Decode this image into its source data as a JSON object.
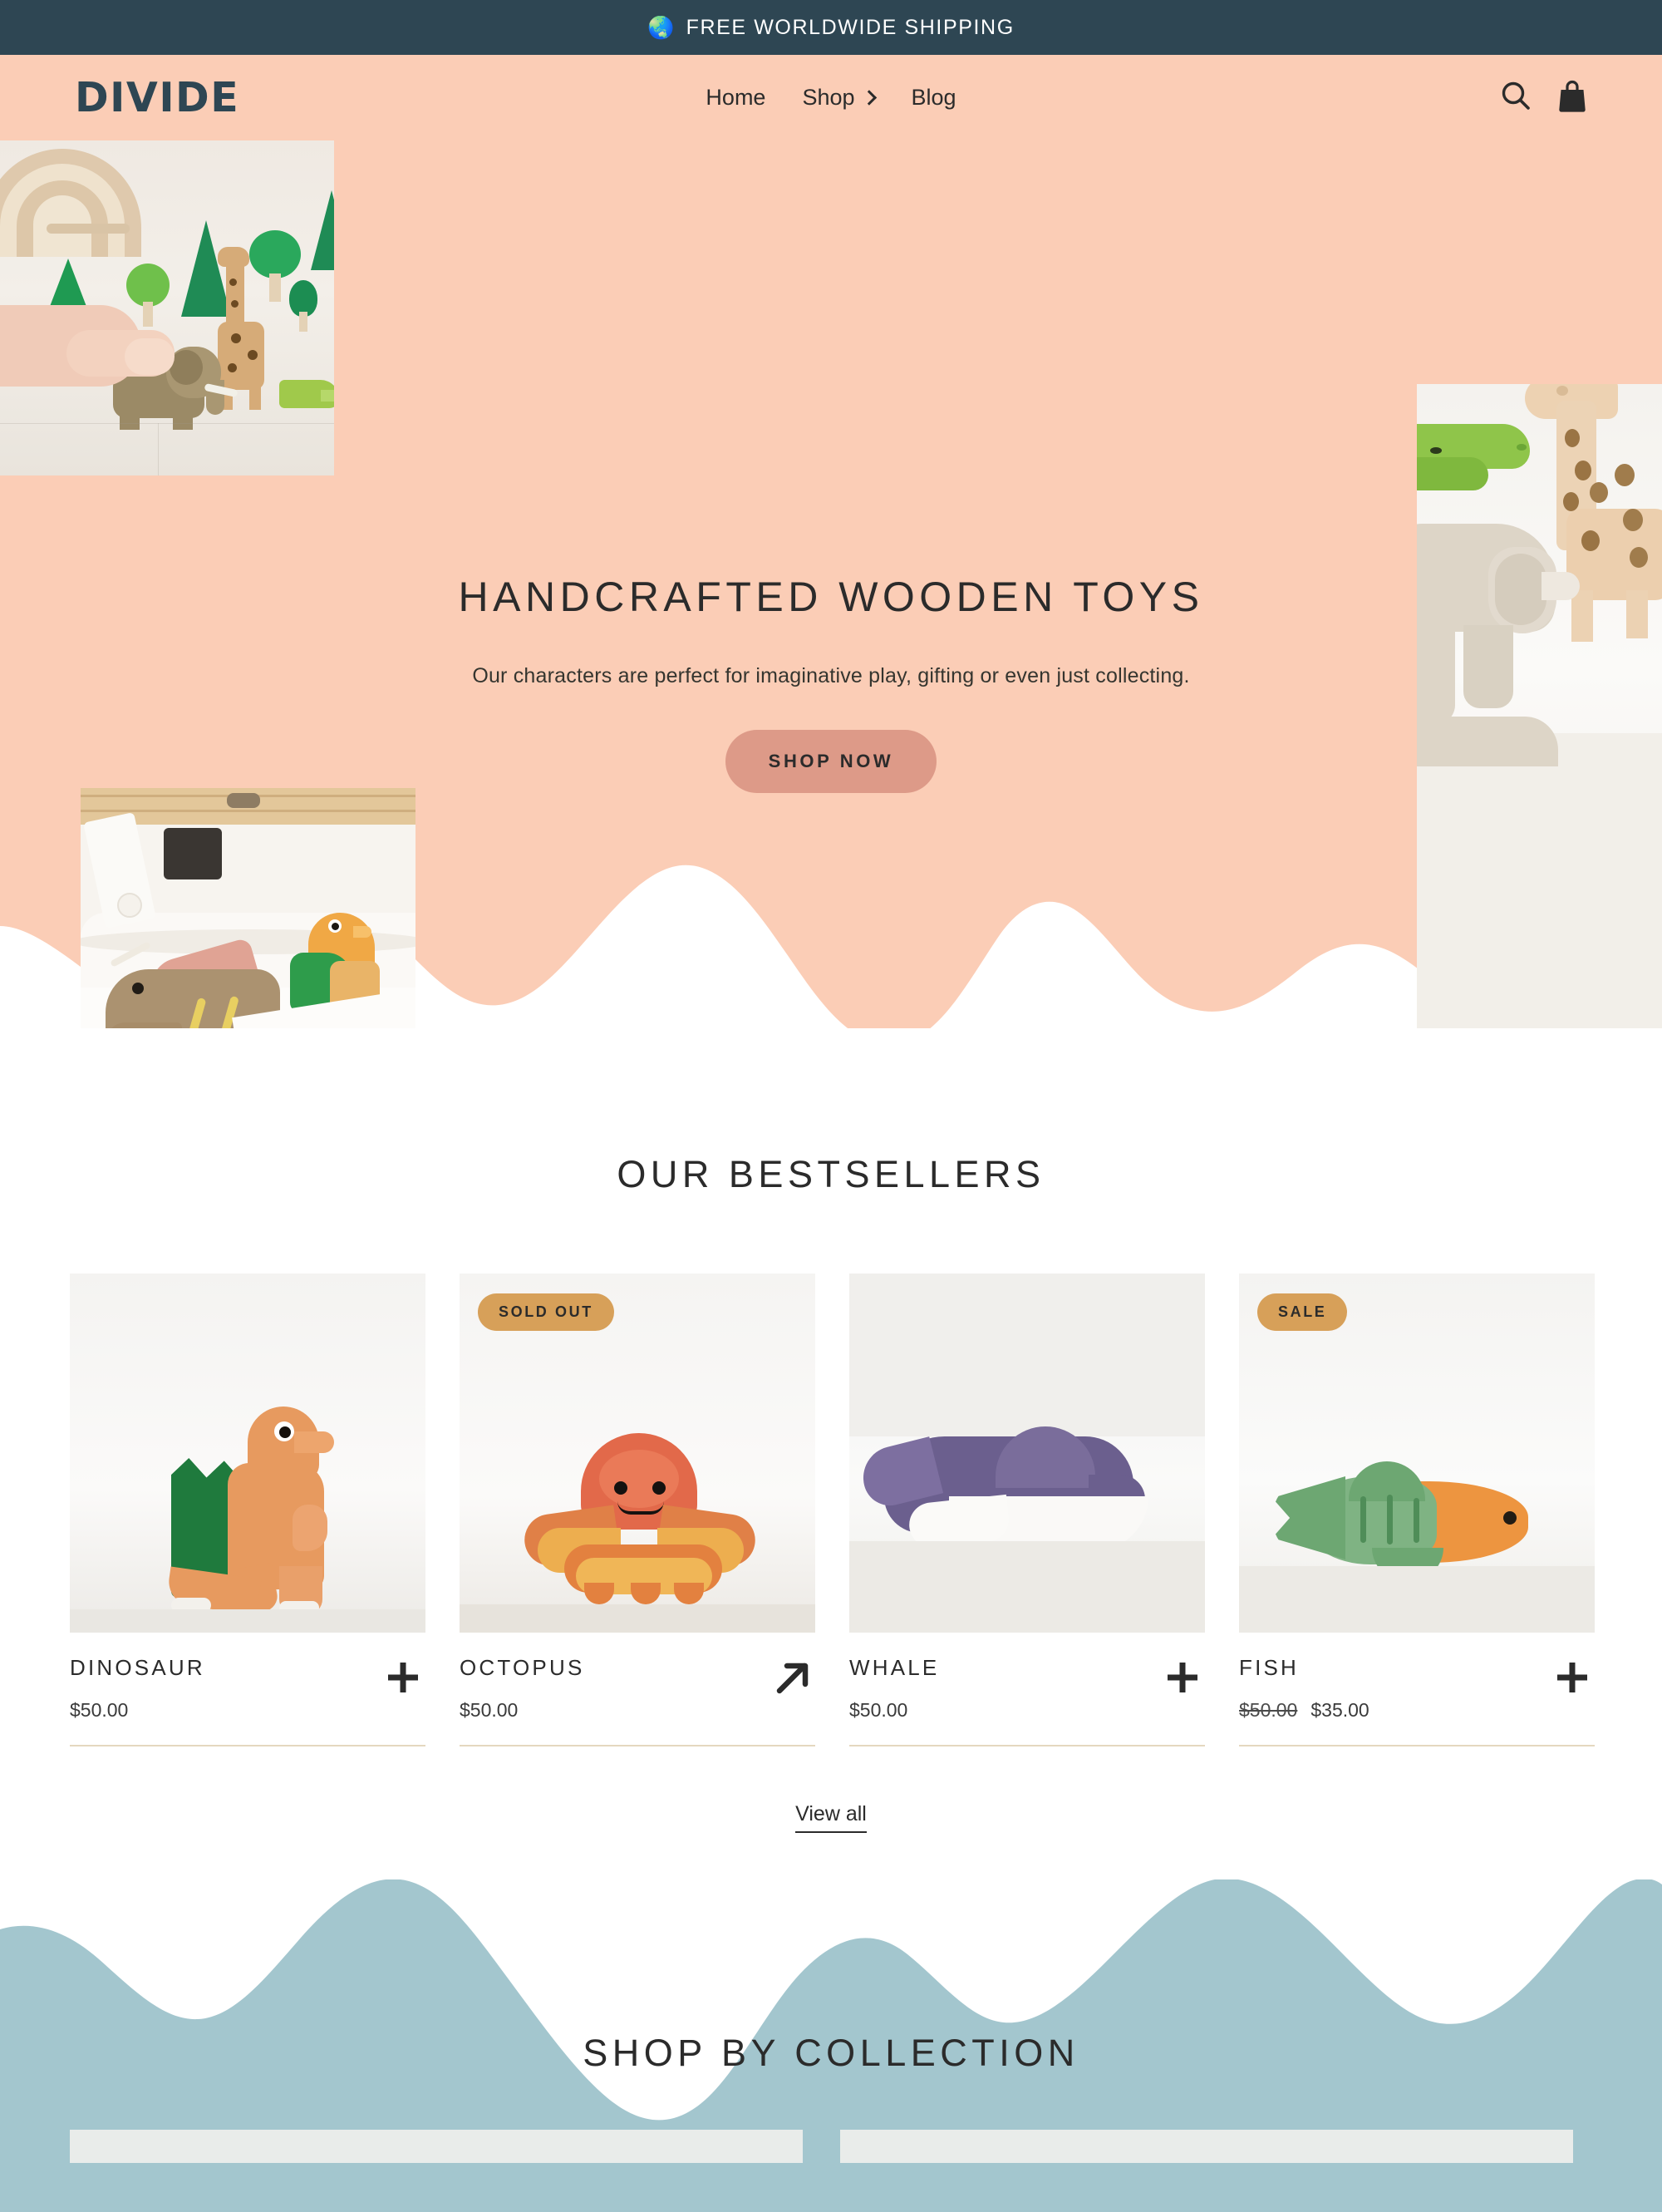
{
  "announcement": {
    "icon": "globe-icon",
    "emoji": "🌏",
    "text": "FREE WORLDWIDE SHIPPING",
    "background": "#2e4653",
    "color": "#ffffff"
  },
  "header": {
    "logo": "DIVIDE",
    "background": "#fbcdb6",
    "logo_color": "#2e4653",
    "nav": [
      {
        "label": "Home",
        "has_chevron": false
      },
      {
        "label": "Shop",
        "has_chevron": true
      },
      {
        "label": "Blog",
        "has_chevron": false
      }
    ],
    "icons": [
      {
        "name": "search-icon",
        "label": "Search"
      },
      {
        "name": "shopping-bag-icon",
        "label": "Cart"
      }
    ]
  },
  "hero": {
    "background": "#fbcdb6",
    "title": "HANDCRAFTED WOODEN TOYS",
    "subtitle": "Our characters are perfect for imaginative play, gifting or even just collecting.",
    "cta": "SHOP NOW",
    "cta_background": "#dd9a88",
    "images": [
      {
        "name": "hero-image-elephant-forest",
        "alt": "Hand placing wooden elephant among green wooden trees and giraffe"
      },
      {
        "name": "hero-image-dinosaurs-in-bed",
        "alt": "Wooden triceratops and orange bird toys tucked in a white bed"
      },
      {
        "name": "hero-image-giraffe-crocodile",
        "alt": "Wooden giraffe, green crocodile and pale wooden elephant"
      }
    ]
  },
  "bestsellers": {
    "title": "OUR BESTSELLERS",
    "view_all": "View all",
    "badge_color": "#d7a059",
    "rule_color": "#e4d8bf",
    "products": [
      {
        "name": "DINOSAUR",
        "price": "$50.00",
        "compare_at": "",
        "badge": "",
        "action_icon": "plus-icon",
        "image_alt": "Orange wooden dinosaur with green sail back"
      },
      {
        "name": "OCTOPUS",
        "price": "$50.00",
        "compare_at": "",
        "badge": "SOLD OUT",
        "action_icon": "arrow-up-right-icon",
        "image_alt": "Orange and yellow wooden octopus with smiling face"
      },
      {
        "name": "WHALE",
        "price": "$50.00",
        "compare_at": "",
        "badge": "",
        "action_icon": "plus-icon",
        "image_alt": "Purple and white wooden whale"
      },
      {
        "name": "FISH",
        "price": "$35.00",
        "compare_at": "$50.00",
        "badge": "SALE",
        "action_icon": "plus-icon",
        "image_alt": "Orange and green wooden fish"
      }
    ]
  },
  "collection": {
    "title": "SHOP BY COLLECTION",
    "background": "#a3c6ce",
    "cards": [
      {
        "name": "collection-card-1"
      },
      {
        "name": "collection-card-2"
      }
    ]
  }
}
